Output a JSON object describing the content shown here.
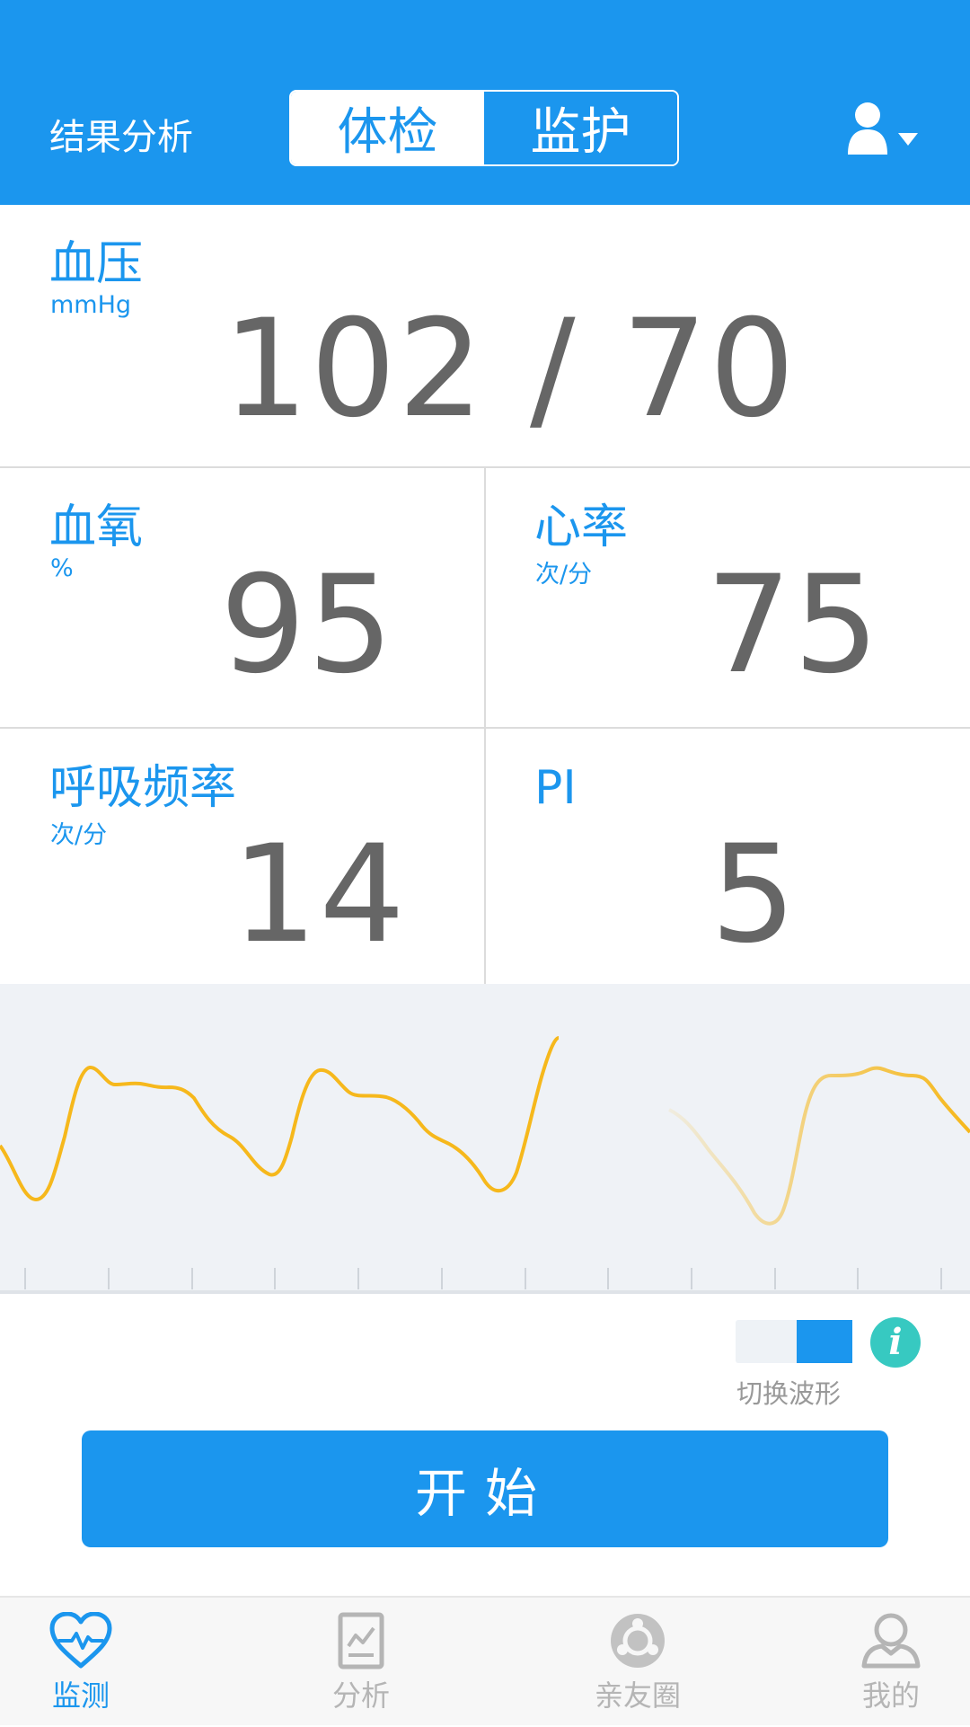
{
  "header": {
    "title": "结果分析",
    "tabs": [
      {
        "label": "体检",
        "active": true
      },
      {
        "label": "监护",
        "active": false
      }
    ],
    "user_icon": "user-icon",
    "dropdown_icon": "caret-down-icon"
  },
  "metrics": {
    "blood_pressure": {
      "label": "血压",
      "unit": "mmHg",
      "value": "102 / 70"
    },
    "spo2": {
      "label": "血氧",
      "unit": "%",
      "value": "95"
    },
    "heart_rate": {
      "label": "心率",
      "unit": "次/分",
      "value": "75"
    },
    "resp_rate": {
      "label": "呼吸频率",
      "unit": "次/分",
      "value": "14"
    },
    "pi": {
      "label": "PI",
      "value": "5"
    }
  },
  "waveform": {
    "color": "#f6b81c",
    "background": "#eff2f6"
  },
  "controls": {
    "switch_label": "切换波形",
    "toggle_on": true,
    "info_icon": "info-icon",
    "start_label": "开始"
  },
  "nav": {
    "items": [
      {
        "label": "监测",
        "icon": "heart-pulse-icon",
        "active": true
      },
      {
        "label": "分析",
        "icon": "report-chart-icon",
        "active": false
      },
      {
        "label": "亲友圈",
        "icon": "friends-circle-icon",
        "active": false
      },
      {
        "label": "我的",
        "icon": "profile-icon",
        "active": false
      }
    ]
  },
  "colors": {
    "accent": "#1b96ee",
    "value_text": "#666666",
    "info": "#37c9c1"
  }
}
